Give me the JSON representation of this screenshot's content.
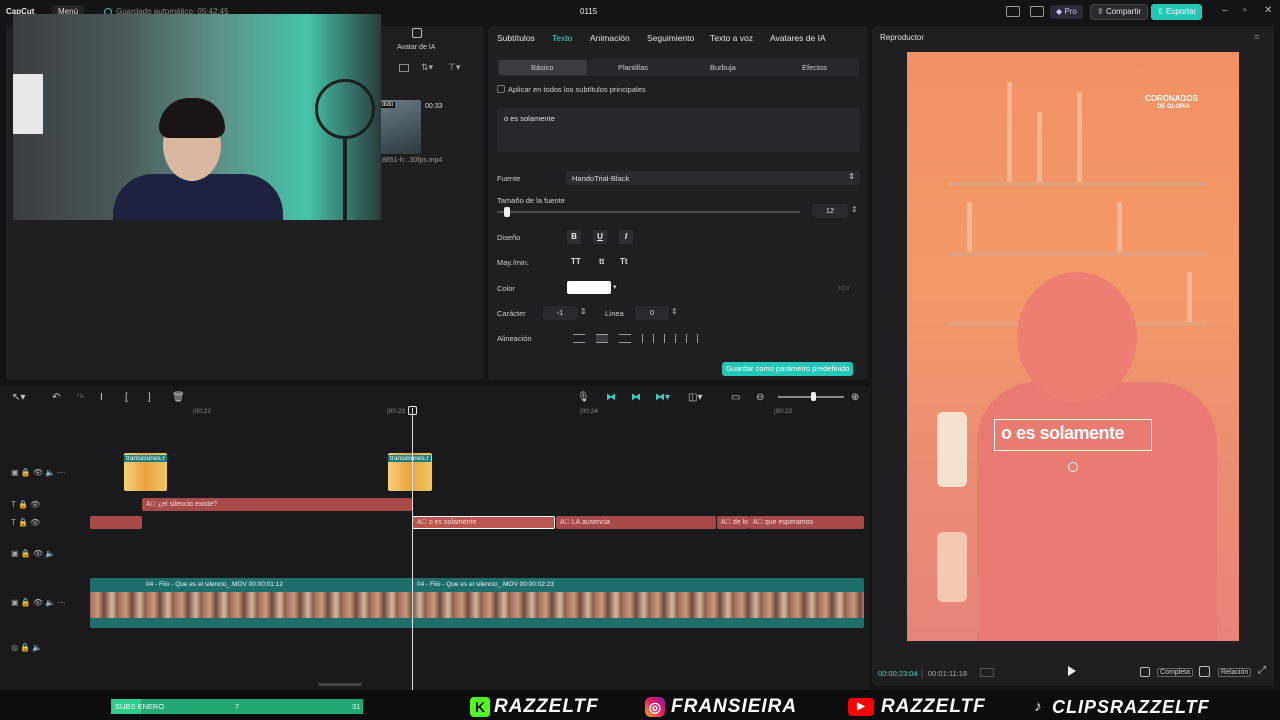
{
  "topbar": {
    "logo": "CapCut",
    "menu_label": "Menú",
    "autosave": "Guardado automático: 05:42:45",
    "project_title": "0115",
    "pro_label": "Pro",
    "share_label": "Compartir",
    "export_label": "Exportar"
  },
  "media": {
    "tab_ai_avatar": "Avatar de IA",
    "tab_prev": "las",
    "badge": "dido",
    "duration": "00:33",
    "filename": "8851-h...30fps.mp4"
  },
  "props": {
    "tabs": [
      "Subtítulos",
      "Texto",
      "Animación",
      "Seguimiento",
      "Texto a voz",
      "Avatares de IA"
    ],
    "subtabs": [
      "Básico",
      "Plantillas",
      "Burbuja",
      "Efectos"
    ],
    "apply_all": "Aplicar en todos los subtítulos principales",
    "text_value": "o es solamente",
    "font_label": "Fuente",
    "font_value": "HandoTrial-Black",
    "size_label": "Tamaño de la fuente",
    "size_value": "12",
    "design_label": "Diseño",
    "bold": "B",
    "underline": "U",
    "italic": "I",
    "case_label": "May./min.",
    "case_upper": "TT",
    "case_lower": "tt",
    "case_title": "Tt",
    "color_label": "Color",
    "color_value": "#ffffff",
    "char_label": "Carácter",
    "char_value": "-1",
    "line_label": "Línea",
    "line_value": "0",
    "align_label": "Alineación",
    "save_preset": "Guardar como parámetro predefinido"
  },
  "player": {
    "title": "Reproductor",
    "poster_line1": "CORONADOS",
    "poster_line2": "DE GLORIA",
    "caption": "o es solamente",
    "time_current": "00:00:23:04",
    "time_total": "00:01:11:18",
    "full_label": "Completa",
    "ratio_label": "Relación"
  },
  "timeline": {
    "ruler": [
      "|00:22",
      "|00:23",
      "|00:24",
      "|00:23"
    ],
    "fx_clip_1": "transiciones.r",
    "fx_clip_2": "transiciones.r",
    "text_clip_1": "¿el silencio existe?",
    "text_clip_selected": "o es solamente",
    "text_clip_3": "LA ausencia",
    "text_clip_4": "de lo",
    "text_clip_5": "que esperamos",
    "video_clip_1": "04 - Filo - Que es el silencio_.MOV   00:00:01:12",
    "video_clip_2": "04 - Filo - Que es el silencio_.MOV   00:00:02:23"
  },
  "overlay": {
    "subs_label": "SUBS ENERO",
    "subs_current": "7",
    "subs_goal": "31",
    "subs_progress": 0.12,
    "social_1": "RAZZELTF",
    "social_2": "FRANSIEIRA",
    "social_3": "RAZZELTF",
    "social_4": "CLIPSRAZZELTF"
  },
  "colors": {
    "accent": "#22c7b7",
    "text_clip": "#a84a4a",
    "video_track": "#1e6f6c"
  }
}
